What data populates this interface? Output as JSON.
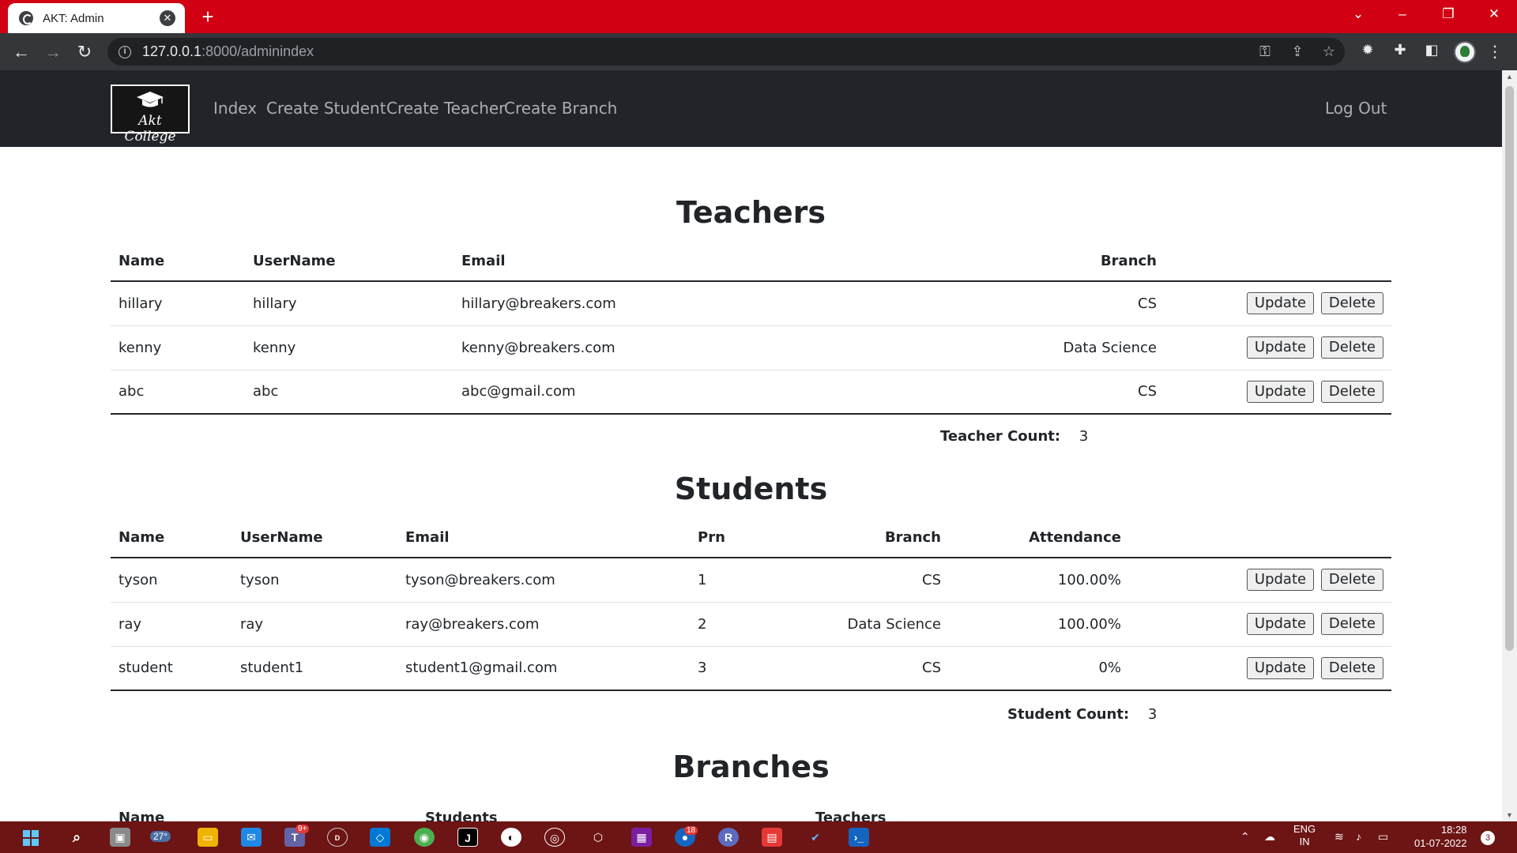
{
  "browser": {
    "tab_title": "AKT: Admin",
    "url_host": "127.0.0.1",
    "url_path": ":8000/adminindex"
  },
  "navbar": {
    "brand_text": "Akt College",
    "links": [
      "Index",
      "Create Student",
      "Create Teacher",
      "Create Branch"
    ],
    "logout": "Log Out"
  },
  "teachers": {
    "title": "Teachers",
    "headers": [
      "Name",
      "UserName",
      "Email",
      "Branch"
    ],
    "rows": [
      {
        "name": "hillary",
        "username": "hillary",
        "email": "hillary@breakers.com",
        "branch": "CS"
      },
      {
        "name": "kenny",
        "username": "kenny",
        "email": "kenny@breakers.com",
        "branch": "Data Science"
      },
      {
        "name": "abc",
        "username": "abc",
        "email": "abc@gmail.com",
        "branch": "CS"
      }
    ],
    "count_label": "Teacher Count:",
    "count_value": "3"
  },
  "students": {
    "title": "Students",
    "headers": [
      "Name",
      "UserName",
      "Email",
      "Prn",
      "Branch",
      "Attendance"
    ],
    "rows": [
      {
        "name": "tyson",
        "username": "tyson",
        "email": "tyson@breakers.com",
        "prn": "1",
        "branch": "CS",
        "attendance": "100.00%"
      },
      {
        "name": "ray",
        "username": "ray",
        "email": "ray@breakers.com",
        "prn": "2",
        "branch": "Data Science",
        "attendance": "100.00%"
      },
      {
        "name": "student",
        "username": "student1",
        "email": "student1@gmail.com",
        "prn": "3",
        "branch": "CS",
        "attendance": "0%"
      }
    ],
    "count_label": "Student Count:",
    "count_value": "3"
  },
  "branches": {
    "title": "Branches",
    "headers": [
      "Name",
      "Students",
      "Teachers"
    ]
  },
  "buttons": {
    "update": "Update",
    "delete": "Delete"
  },
  "taskbar": {
    "weather": "27°",
    "lang": "ENG",
    "lang_region": "IN",
    "time": "18:28",
    "date": "01-07-2022",
    "notification_count": "3",
    "badge_teams": "9+",
    "badge_app": "18"
  }
}
